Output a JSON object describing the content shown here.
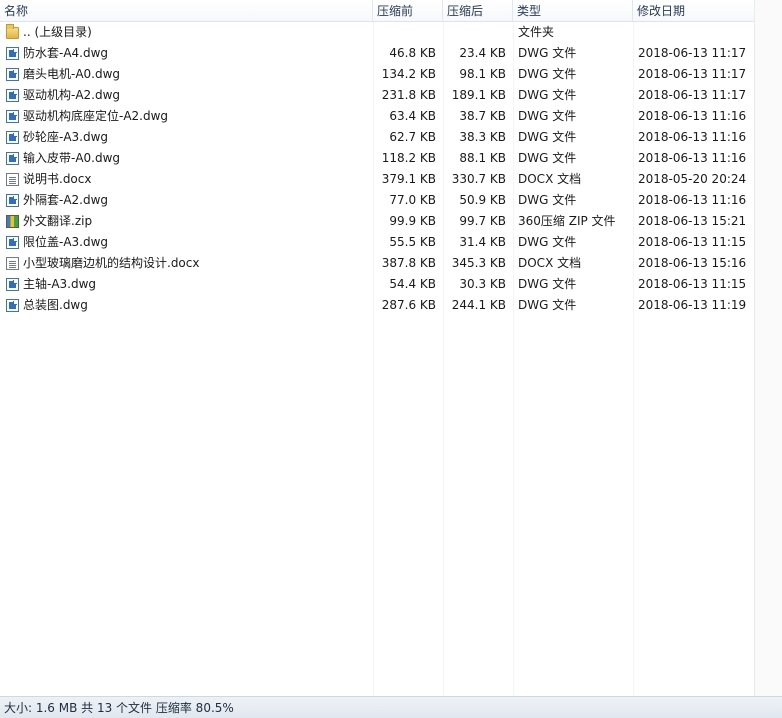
{
  "columns": {
    "name": "名称",
    "compressed_size": "压缩前",
    "size": "压缩后",
    "type": "类型",
    "modified": "修改日期"
  },
  "rows": [
    {
      "icon": "folder-icon",
      "name": ".. (上级目录)",
      "csize": "",
      "size": "",
      "type": "文件夹",
      "modified": ""
    },
    {
      "icon": "dwg-file-icon",
      "name": "防水套-A4.dwg",
      "csize": "46.8 KB",
      "size": "23.4 KB",
      "type": "DWG 文件",
      "modified": "2018-06-13 11:17"
    },
    {
      "icon": "dwg-file-icon",
      "name": "磨头电机-A0.dwg",
      "csize": "134.2 KB",
      "size": "98.1 KB",
      "type": "DWG 文件",
      "modified": "2018-06-13 11:17"
    },
    {
      "icon": "dwg-file-icon",
      "name": "驱动机构-A2.dwg",
      "csize": "231.8 KB",
      "size": "189.1 KB",
      "type": "DWG 文件",
      "modified": "2018-06-13 11:17"
    },
    {
      "icon": "dwg-file-icon",
      "name": "驱动机构底座定位-A2.dwg",
      "csize": "63.4 KB",
      "size": "38.7 KB",
      "type": "DWG 文件",
      "modified": "2018-06-13 11:16"
    },
    {
      "icon": "dwg-file-icon",
      "name": "砂轮座-A3.dwg",
      "csize": "62.7 KB",
      "size": "38.3 KB",
      "type": "DWG 文件",
      "modified": "2018-06-13 11:16"
    },
    {
      "icon": "dwg-file-icon",
      "name": "输入皮带-A0.dwg",
      "csize": "118.2 KB",
      "size": "88.1 KB",
      "type": "DWG 文件",
      "modified": "2018-06-13 11:16"
    },
    {
      "icon": "docx-file-icon",
      "name": "说明书.docx",
      "csize": "379.1 KB",
      "size": "330.7 KB",
      "type": "DOCX 文档",
      "modified": "2018-05-20 20:24"
    },
    {
      "icon": "dwg-file-icon",
      "name": "外隔套-A2.dwg",
      "csize": "77.0 KB",
      "size": "50.9 KB",
      "type": "DWG 文件",
      "modified": "2018-06-13 11:16"
    },
    {
      "icon": "zip-file-icon",
      "name": "外文翻译.zip",
      "csize": "99.9 KB",
      "size": "99.7 KB",
      "type": "360压缩 ZIP 文件",
      "modified": "2018-06-13 15:21"
    },
    {
      "icon": "dwg-file-icon",
      "name": "限位盖-A3.dwg",
      "csize": "55.5 KB",
      "size": "31.4 KB",
      "type": "DWG 文件",
      "modified": "2018-06-13 11:15"
    },
    {
      "icon": "docx-file-icon",
      "name": "小型玻璃磨边机的结构设计.docx",
      "csize": "387.8 KB",
      "size": "345.3 KB",
      "type": "DOCX 文档",
      "modified": "2018-06-13 15:16"
    },
    {
      "icon": "dwg-file-icon",
      "name": "主轴-A3.dwg",
      "csize": "54.4 KB",
      "size": "30.3 KB",
      "type": "DWG 文件",
      "modified": "2018-06-13 11:15"
    },
    {
      "icon": "dwg-file-icon",
      "name": "总装图.dwg",
      "csize": "287.6 KB",
      "size": "244.1 KB",
      "type": "DWG 文件",
      "modified": "2018-06-13 11:19"
    }
  ],
  "status": "大小: 1.6 MB 共 13 个文件 压缩率 80.5%"
}
